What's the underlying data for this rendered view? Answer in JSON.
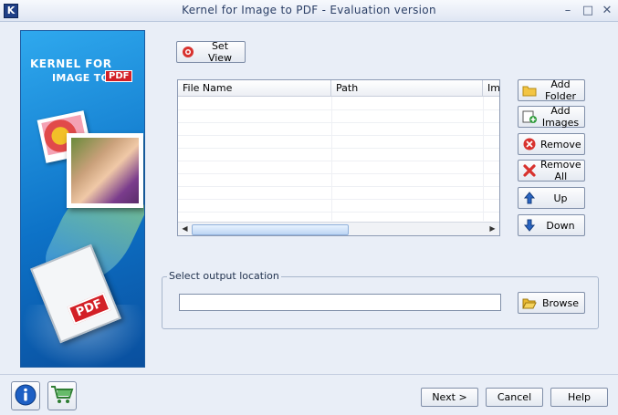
{
  "window": {
    "app_icon": "K",
    "title": "Kernel for Image to PDF - Evaluation version",
    "minimize_glyph": "–",
    "maximize_glyph": "□",
    "close_glyph": "✕"
  },
  "banner": {
    "brand_line1": "KERNEL FOR",
    "brand_line2": "IMAGE TO",
    "brand_pdf": "PDF",
    "doc_tag": "PDF"
  },
  "toolbar": {
    "set_view_label": "Set View"
  },
  "file_table": {
    "columns": [
      "File Name",
      "Path",
      "Ima"
    ],
    "rows": []
  },
  "side_buttons": {
    "add_folder": "Add Folder",
    "add_images": "Add Images",
    "remove": "Remove",
    "remove_all": "Remove All",
    "up": "Up",
    "down": "Down"
  },
  "output": {
    "group_label": "Select output location",
    "path_value": "",
    "browse_label": "Browse"
  },
  "footer": {
    "next_label": "Next >",
    "cancel_label": "Cancel",
    "help_label": "Help"
  },
  "icons": {
    "info": "info-icon",
    "cart": "cart-icon",
    "set_view": "gear-icon",
    "add_folder": "folder-icon",
    "add_images": "add-image-icon",
    "remove": "remove-icon",
    "remove_all": "remove-all-icon",
    "up": "arrow-up-icon",
    "down": "arrow-down-icon",
    "browse": "open-folder-icon"
  },
  "colors": {
    "window_bg": "#e9eef7",
    "banner_blue": "#0d72c7",
    "pdf_red": "#d32027"
  }
}
